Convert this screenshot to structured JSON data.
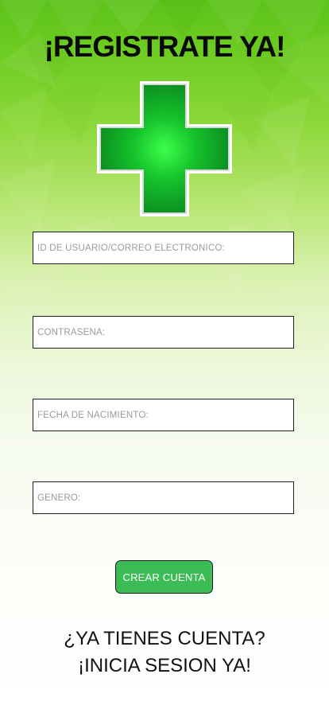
{
  "header": {
    "title": "¡REGISTRATE YA!"
  },
  "logo": {
    "icon": "pharmacy-cross-icon",
    "color": "#1fbf3a"
  },
  "form": {
    "user_placeholder": "ID DE USUARIO/CORREO ELECTRÓNICO:",
    "password_placeholder": "CONTRASEÑA:",
    "birthdate_placeholder": "FECHA DE NACIMIENTO:",
    "gender_placeholder": "GÉNERO:",
    "submit_label": "CREAR CUENTA",
    "submit_color": "#3cbc55"
  },
  "footer": {
    "prompt": "¿YA TIENES CUENTA?",
    "link": "¡INICIA SESION YA!"
  },
  "colors": {
    "background_top": "#5cc21a",
    "background_bottom": "#ffffff"
  }
}
